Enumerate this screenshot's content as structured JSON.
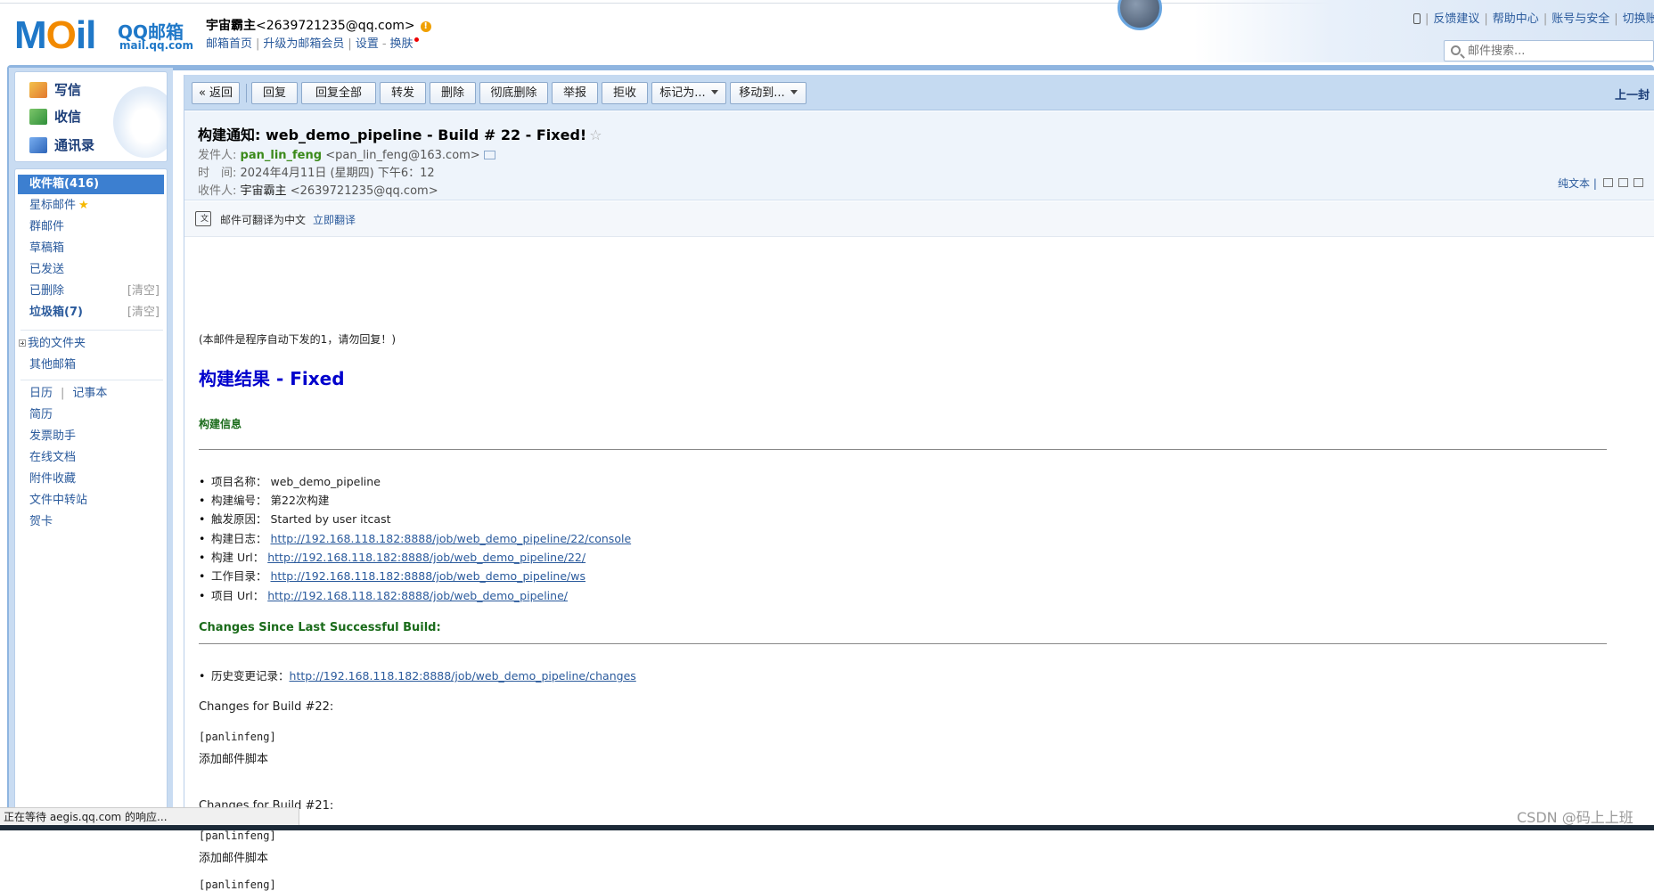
{
  "logo": {
    "word": [
      "M",
      "O",
      "il"
    ],
    "brand": "QQ邮箱",
    "domain": "mail.qq.com"
  },
  "user": {
    "name": "宇宙霸主",
    "email": "<2639721235@qq.com>",
    "links": [
      "邮箱首页",
      "升级为邮箱会员",
      "设置",
      "换肤"
    ]
  },
  "toplinks": [
    "反馈建议",
    "帮助中心",
    "账号与安全",
    "切换账"
  ],
  "search": {
    "placeholder": "邮件搜索..."
  },
  "quick": [
    "写信",
    "收信",
    "通讯录"
  ],
  "folders": {
    "inbox": "收件箱(416)",
    "starred": "星标邮件",
    "group": "群邮件",
    "drafts": "草稿箱",
    "sent": "已发送",
    "deleted": "已删除",
    "spam": "垃圾箱(7)",
    "clear": "[清空]",
    "my_folders": "我的文件夹",
    "other_mail": "其他邮箱",
    "calendar": "日历",
    "notes": "记事本",
    "resume": "简历",
    "invoice": "发票助手",
    "docs": "在线文档",
    "attachments": "附件收藏",
    "transfer": "文件中转站",
    "cards": "贺卡"
  },
  "toolbar": {
    "back": "« 返回",
    "reply": "回复",
    "reply_all": "回复全部",
    "forward": "转发",
    "delete": "删除",
    "delete_permanent": "彻底删除",
    "report": "举报",
    "reject": "拒收",
    "mark_as": "标记为...",
    "move_to": "移动到...",
    "prev": "上一封"
  },
  "mail": {
    "subject": "构建通知: web_demo_pipeline - Build # 22 - Fixed!",
    "from_label": "发件人:",
    "from_name": "pan_lin_feng",
    "from_email": "<pan_lin_feng@163.com>",
    "time_label": "时　间:",
    "time_value": "2024年4月11日 (星期四) 下午6：12",
    "to_label": "收件人:",
    "to_name": "宇宙霸主",
    "to_email": "<2639721235@qq.com>",
    "plaintext": "纯文本 |"
  },
  "translate": {
    "text": "邮件可翻译为中文",
    "action": "立即翻译"
  },
  "body": {
    "auto_note": "(本邮件是程序自动下发的1，请勿回复！)",
    "result_title": "构建结果 - Fixed",
    "info_title": "构建信息",
    "items": [
      {
        "label": "项目名称：",
        "value": "web_demo_pipeline",
        "link": ""
      },
      {
        "label": "构建编号：",
        "value": "第22次构建",
        "link": ""
      },
      {
        "label": "触发原因：",
        "value": "Started by user itcast",
        "link": ""
      },
      {
        "label": "构建日志：",
        "value": "",
        "link": "http://192.168.118.182:8888/job/web_demo_pipeline/22/console"
      },
      {
        "label": "构建  Url：",
        "value": "",
        "link": "http://192.168.118.182:8888/job/web_demo_pipeline/22/"
      },
      {
        "label": "工作目录：",
        "value": "",
        "link": "http://192.168.118.182:8888/job/web_demo_pipeline/ws"
      },
      {
        "label": "项目  Url：",
        "value": "",
        "link": "http://192.168.118.182:8888/job/web_demo_pipeline/"
      }
    ],
    "changes_title": "Changes Since Last Successful Build:",
    "history_label": "历史变更记录：",
    "history_link": "http://192.168.118.182:8888/job/web_demo_pipeline/changes",
    "build22_title": "Changes for Build #22:",
    "build22_author": "[panlinfeng]",
    "build22_msg": "添加邮件脚本",
    "build21_title": "Changes for Build #21:",
    "build21_author": "[panlinfeng]",
    "build21_msg": "添加邮件脚本",
    "cut_line": "[panlinfeng]"
  },
  "status": "正在等待 aegis.qq.com 的响应...",
  "watermark": "CSDN @码上上班",
  "colors": {
    "accent": "#3c7fd0",
    "frame": "#8fb5e0",
    "section_green": "#1a6b1a",
    "title_blue": "#0000cc"
  }
}
